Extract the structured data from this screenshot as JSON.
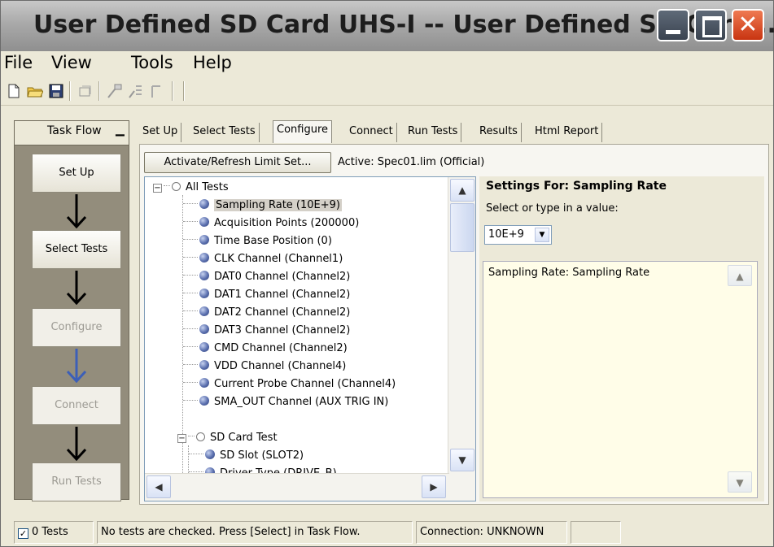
{
  "window": {
    "title": "User Defined SD Card UHS-I -- User Defined SD Card ..."
  },
  "menu": [
    "File",
    "View",
    "Tools",
    "Help"
  ],
  "taskflow": {
    "label": "Task Flow",
    "steps": [
      "Set Up",
      "Select Tests",
      "Configure",
      "Connect",
      "Run Tests"
    ]
  },
  "tabs": [
    "Set Up",
    "Select Tests",
    "Configure",
    "Connect",
    "Run Tests",
    "Results",
    "Html Report"
  ],
  "configure": {
    "activate_button": "Activate/Refresh Limit Set...",
    "active_label": "Active:  Spec01.lim (Official)"
  },
  "tree": {
    "root": "All Tests",
    "items": [
      "Sampling Rate (10E+9)",
      "Acquisition Points (200000)",
      "Time Base Position (0)",
      "CLK Channel (Channel1)",
      "DAT0 Channel (Channel2)",
      "DAT1 Channel (Channel2)",
      "DAT2 Channel (Channel2)",
      "DAT3 Channel (Channel2)",
      "CMD Channel (Channel2)",
      "VDD Channel (Channel4)",
      "Current Probe Channel (Channel4)",
      "SMA_OUT Channel (AUX TRIG IN)"
    ],
    "group": "SD Card Test",
    "group_items": [
      "SD Slot (SLOT2)",
      "Driver Type (DRIVE_B)"
    ]
  },
  "settings": {
    "header": "Settings For: Sampling Rate",
    "prompt": "Select or type in a value:",
    "value": "10E+9",
    "description": "Sampling Rate: Sampling Rate"
  },
  "status": {
    "tests": "0 Tests",
    "message": "No tests are checked. Press [Select] in Task Flow.",
    "connection": "Connection: UNKNOWN"
  }
}
